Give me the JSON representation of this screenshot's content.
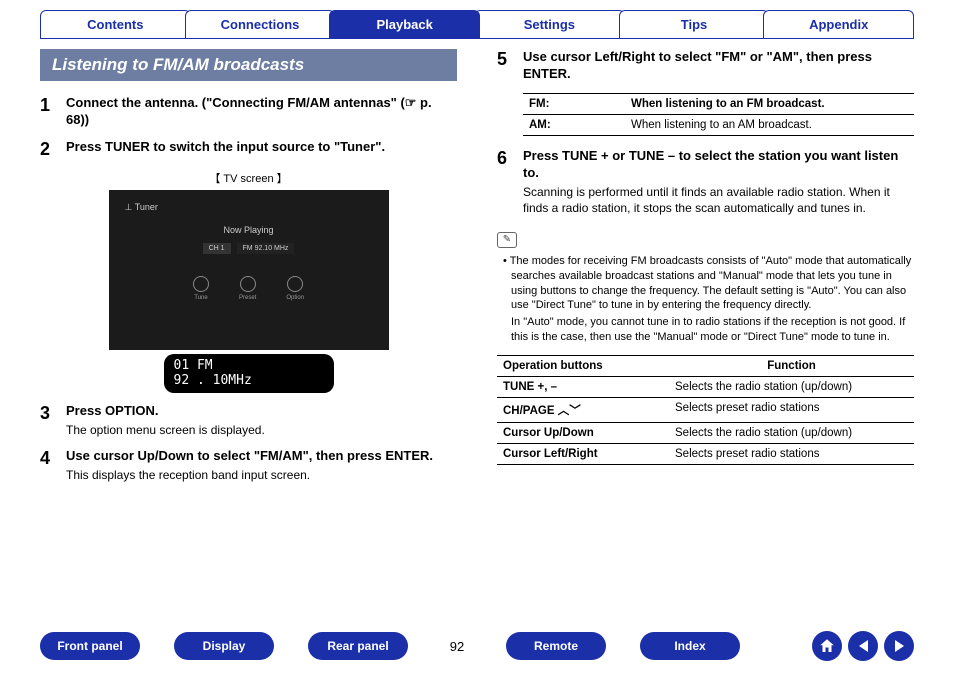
{
  "topnav": {
    "items": [
      "Contents",
      "Connections",
      "Playback",
      "Settings",
      "Tips",
      "Appendix"
    ],
    "active": 2
  },
  "section_title": "Listening to FM/AM broadcasts",
  "left": {
    "s1": "Connect the antenna. (\"Connecting FM/AM antennas\" (☞ p. 68))",
    "s2": "Press TUNER to switch the input source to \"Tuner\".",
    "tv_label": "【 TV screen 】",
    "tv": {
      "tuner": "Tuner",
      "np": "Now Playing",
      "ch": "CH 1",
      "freq": "FM 92.10 MHz",
      "ic1": "Tune",
      "ic2": "Preset",
      "ic3": "Option"
    },
    "lcd": {
      "l1": "01   FM",
      "l2": " 92 . 10MHz"
    },
    "s3": "Press OPTION.",
    "s3d": "The option menu screen is displayed.",
    "s4": "Use cursor Up/Down to select \"FM/AM\", then press ENTER.",
    "s4d": "This displays the reception band input screen."
  },
  "right": {
    "s5": "Use cursor Left/Right to select \"FM\" or \"AM\", then press ENTER.",
    "fmam": [
      {
        "k": "FM:",
        "v": "When listening to an FM broadcast."
      },
      {
        "k": "AM:",
        "v": "When listening to an AM broadcast."
      }
    ],
    "s6": "Press TUNE + or TUNE – to select the station you want listen to.",
    "s6d": "Scanning is performed until it finds an available radio station. When it finds a radio station, it stops the scan automatically and tunes in.",
    "note1": "• The modes for receiving FM broadcasts consists of \"Auto\" mode that automatically searches available broadcast stations and \"Manual\" mode that lets you tune in using buttons to change the frequency. The default setting is \"Auto\". You can also use \"Direct Tune\" to tune in by entering the frequency directly.",
    "note2": "In \"Auto\" mode, you cannot tune in to radio stations if the reception is not good. If this is the case, then use the \"Manual\" mode or \"Direct Tune\" mode to tune in.",
    "ops_head": {
      "c1": "Operation buttons",
      "c2": "Function"
    },
    "ops": [
      {
        "k": "TUNE +, –",
        "v": "Selects the radio station (up/down)"
      },
      {
        "k": "CH/PAGE ︿﹀",
        "v": "Selects preset radio stations"
      },
      {
        "k": "Cursor Up/Down",
        "v": "Selects the radio station (up/down)"
      },
      {
        "k": "Cursor Left/Right",
        "v": "Selects preset radio stations"
      }
    ]
  },
  "footer": {
    "btns": [
      "Front panel",
      "Display",
      "Rear panel"
    ],
    "page": "92",
    "btns2": [
      "Remote",
      "Index"
    ]
  }
}
